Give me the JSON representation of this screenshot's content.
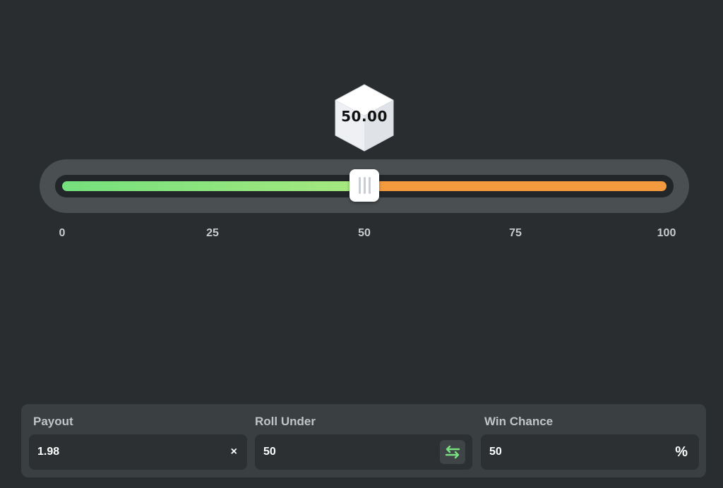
{
  "result": {
    "value": "50.00"
  },
  "slider": {
    "value": 50,
    "min": 0,
    "max": 100,
    "ticks": [
      "0",
      "25",
      "50",
      "75",
      "100"
    ],
    "colors": {
      "win": "#74e07d",
      "lose": "#f39a3e"
    }
  },
  "controls": {
    "payout": {
      "label": "Payout",
      "value": "1.98",
      "suffix": "×"
    },
    "roll": {
      "label": "Roll Under",
      "value": "50",
      "icon": "swap-arrows-icon"
    },
    "chance": {
      "label": "Win Chance",
      "value": "50",
      "suffix": "%"
    }
  }
}
